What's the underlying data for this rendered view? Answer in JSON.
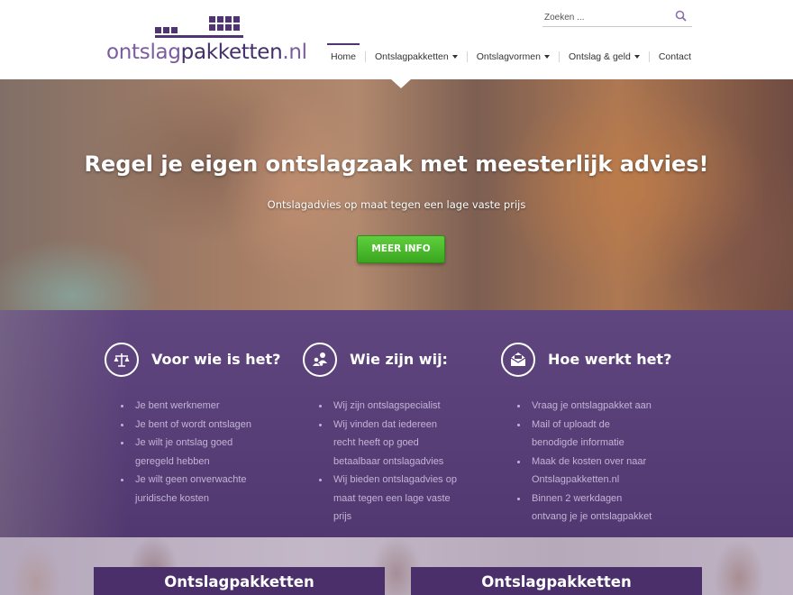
{
  "brand": {
    "name_part1": "ontslag",
    "name_part2": "pakketten",
    "name_part3": ".nl",
    "logo_color": "#4f3373"
  },
  "search": {
    "placeholder": "Zoeken ...",
    "value": ""
  },
  "nav": {
    "items": [
      {
        "label": "Home",
        "active": true,
        "has_dropdown": false
      },
      {
        "label": "Ontslagpakketten",
        "active": false,
        "has_dropdown": true
      },
      {
        "label": "Ontslagvormen",
        "active": false,
        "has_dropdown": true
      },
      {
        "label": "Ontslag & geld",
        "active": false,
        "has_dropdown": true
      },
      {
        "label": "Contact",
        "active": false,
        "has_dropdown": false
      }
    ]
  },
  "hero": {
    "title": "Regel je eigen ontslagzaak met meesterlijk advies!",
    "subtitle": "Ontslagadvies op maat tegen een lage vaste prijs",
    "button_label": "MEER INFO",
    "button_color": "#4cbb2e"
  },
  "info": {
    "background_color": "#5a3f78",
    "columns": [
      {
        "icon": "scale-icon",
        "title": "Voor wie is het?",
        "bullets": [
          "Je bent werknemer",
          "Je bent of wordt ontslagen",
          "Je wilt je ontslag goed",
          "geregeld hebben",
          "Je wilt geen onverwachte",
          "juridische kosten"
        ]
      },
      {
        "icon": "people-icon",
        "title": "Wie zijn wij:",
        "bullets": [
          "Wij zijn ontslagspecialist",
          "Wij vinden dat iedereen",
          "recht heeft op goed",
          "betaalbaar ontslagadvies",
          "Wij bieden ontslagadvies op",
          "maat tegen een lage vaste",
          "prijs"
        ]
      },
      {
        "icon": "envelope-icon",
        "title": "Hoe werkt het?",
        "bullets": [
          "Vraag je ontslagpakket aan",
          "Mail of uploadt de",
          "benodigde informatie",
          "Maak de kosten over naar",
          "Ontslagpakketten.nl",
          "Binnen 2 werkdagen",
          "ontvang je je ontslagpakket"
        ]
      }
    ]
  },
  "packages": {
    "cards": [
      {
        "title": "Ontslagpakketten"
      },
      {
        "title": "Ontslagpakketten"
      }
    ]
  }
}
